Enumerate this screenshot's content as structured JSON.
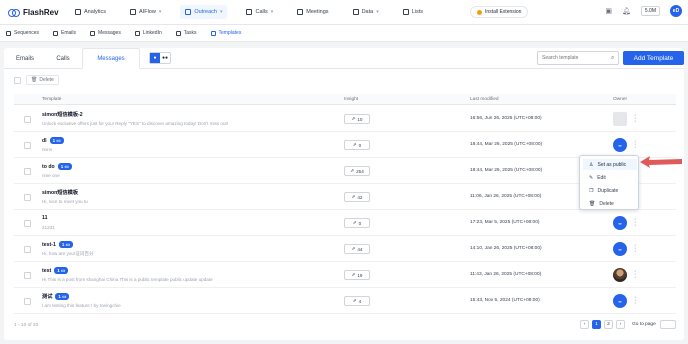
{
  "app": {
    "name": "FlashRev"
  },
  "nav": [
    {
      "label": "Analytics",
      "icon": "chart-icon",
      "chevron": false
    },
    {
      "label": "AIFlow",
      "icon": "flow-icon",
      "chevron": true
    },
    {
      "label": "Outreach",
      "icon": "send-icon",
      "chevron": true,
      "active": true
    },
    {
      "label": "Calls",
      "icon": "phone-icon",
      "chevron": true
    },
    {
      "label": "Meetings",
      "icon": "calendar-icon",
      "chevron": false
    },
    {
      "label": "Data",
      "icon": "database-icon",
      "chevron": true
    },
    {
      "label": "Lists",
      "icon": "list-icon",
      "chevron": false
    }
  ],
  "extension_label": "Install Extension",
  "balance": "5.0M",
  "user_initials": "eD",
  "subnav": [
    {
      "label": "Sequences"
    },
    {
      "label": "Emails"
    },
    {
      "label": "Messages"
    },
    {
      "label": "LinkedIn"
    },
    {
      "label": "Tasks"
    },
    {
      "label": "Templates",
      "active": true
    }
  ],
  "tabs": [
    "Emails",
    "Calls",
    "Messages"
  ],
  "search": {
    "placeholder": "Search template"
  },
  "add_template_label": "Add Template",
  "delete_label": "Delete",
  "columns": {
    "template": "Template",
    "insight": "Insight",
    "last_modified": "Last modified",
    "owner": "Owner"
  },
  "rows": [
    {
      "name": "simon短信模板-2",
      "badge": "",
      "sub": "Unlock exclusive offers just for you! Reply \"YES\" to discover amazing today! Don't miss out!",
      "insight": "10",
      "modified": "16:56, Jun 26, 2025 (UTC+08:00)",
      "owner": "grey"
    },
    {
      "name": "dl",
      "badge": "1",
      "sub": "nnnn",
      "insight": "0",
      "modified": "18:44, Mar 26, 2025 (UTC+08:00)",
      "owner": "blue"
    },
    {
      "name": "to do",
      "badge": "1",
      "sub": "nine one",
      "insight": "254",
      "modified": "18:44, Mar 26, 2025 (UTC+08:00)",
      "owner": "blue"
    },
    {
      "name": "simon短信模板",
      "badge": "",
      "sub": "Hi, nice to meet you tu",
      "insight": "42",
      "modified": "11:06, Jan 26, 2025 (UTC+08:00)",
      "owner": "blue"
    },
    {
      "name": "11",
      "badge": "",
      "sub": "21231",
      "insight": "0",
      "modified": "17:23, Mar 5, 2025 (UTC+08:00)",
      "owner": "blue"
    },
    {
      "name": "test-1",
      "badge": "1",
      "sub": "Hi, how are you!证词百分",
      "insight": "44",
      "modified": "14:10, Jan 26, 2025 (UTC+08:00)",
      "owner": "blue"
    },
    {
      "name": "test",
      "badge": "1",
      "sub": "Hi This is a post from shanghai China This is a public template public update update",
      "insight": "19",
      "modified": "11:43, Jan 26, 2025 (UTC+08:00)",
      "owner": "photo"
    },
    {
      "name": "测试",
      "badge": "1",
      "sub": "I am testing this feature ! by toeingchie",
      "insight": "4",
      "modified": "15:43, Nov 5, 2024 (UTC+08:00)",
      "owner": "blue"
    }
  ],
  "menu": [
    "Set as public",
    "Edit",
    "Duplicate",
    "Delete"
  ],
  "footer_count": "1 - 10 of 20",
  "pages": [
    "1",
    "2"
  ],
  "goto_label": "Go to page",
  "colors": {
    "accent": "#2563eb",
    "arrow": "#e05a5a"
  }
}
